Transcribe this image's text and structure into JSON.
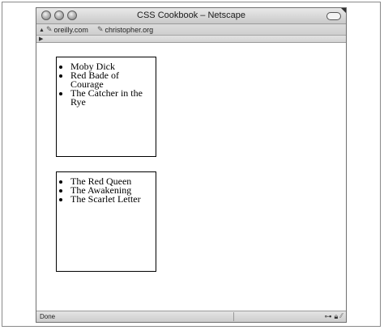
{
  "window": {
    "title": "CSS Cookbook – Netscape"
  },
  "bookmarks": [
    {
      "label": "oreilly.com",
      "icon": "bookmark-icon"
    },
    {
      "label": "christopher.org",
      "icon": "bookmark-icon"
    }
  ],
  "lists": [
    {
      "items": [
        "Moby Dick",
        "Red Bade of Courage",
        "The Catcher in the Rye"
      ]
    },
    {
      "items": [
        "The Red Queen",
        "The Awakening",
        "The Scarlet Letter"
      ]
    }
  ],
  "status": {
    "text": "Done"
  }
}
